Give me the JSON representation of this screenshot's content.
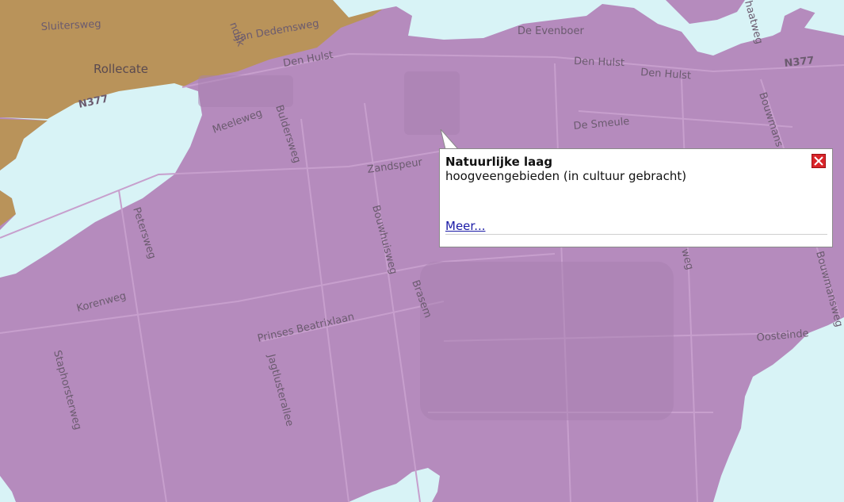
{
  "map": {
    "colors": {
      "peat": "#b58bbd",
      "water": "#d8f3f6",
      "sand": "#b9935a",
      "road_halo": "#c79fcd",
      "built_area": "#a880b0"
    },
    "places": {
      "sluitersweg": "Sluitersweg",
      "rollecate": "Rollecate",
      "van_dedemsweg": "van Dedemsweg",
      "dijk": "ndijk",
      "de_evenboer": "De Evenboer",
      "den_hulst_1": "Den Hulst",
      "den_hulst_2": "Den Hulst",
      "den_hulst_3": "Den Hulst",
      "n377_left": "N377",
      "n377_right": "N377",
      "meeleweg": "Meeleweg",
      "buldersweg": "Buldersweg",
      "de_smeule": "De Smeule",
      "zandspeur": "Zandspeur",
      "bouwhuisweg": "Bouwhuisweg",
      "petersweg": "Petersweg",
      "korenweg": "Korenweg",
      "prinses_beatrixlaan": "Prinses Beatrixlaan",
      "brasem": "Brasem",
      "jagtlusterallee": "Jagtlusterallee",
      "staphorsterweg": "Staphorsterweg",
      "oosteinde": "Oosteinde",
      "bouwmans_1": "Bouwmans",
      "bouwmans_2": "Bouwmansweg",
      "haatweg": "haatweg",
      "weg_fragment": "weg"
    }
  },
  "popup": {
    "title": "Natuurlijke laag",
    "text": "hoogveengebieden (in cultuur gebracht)",
    "link": "Meer..."
  }
}
